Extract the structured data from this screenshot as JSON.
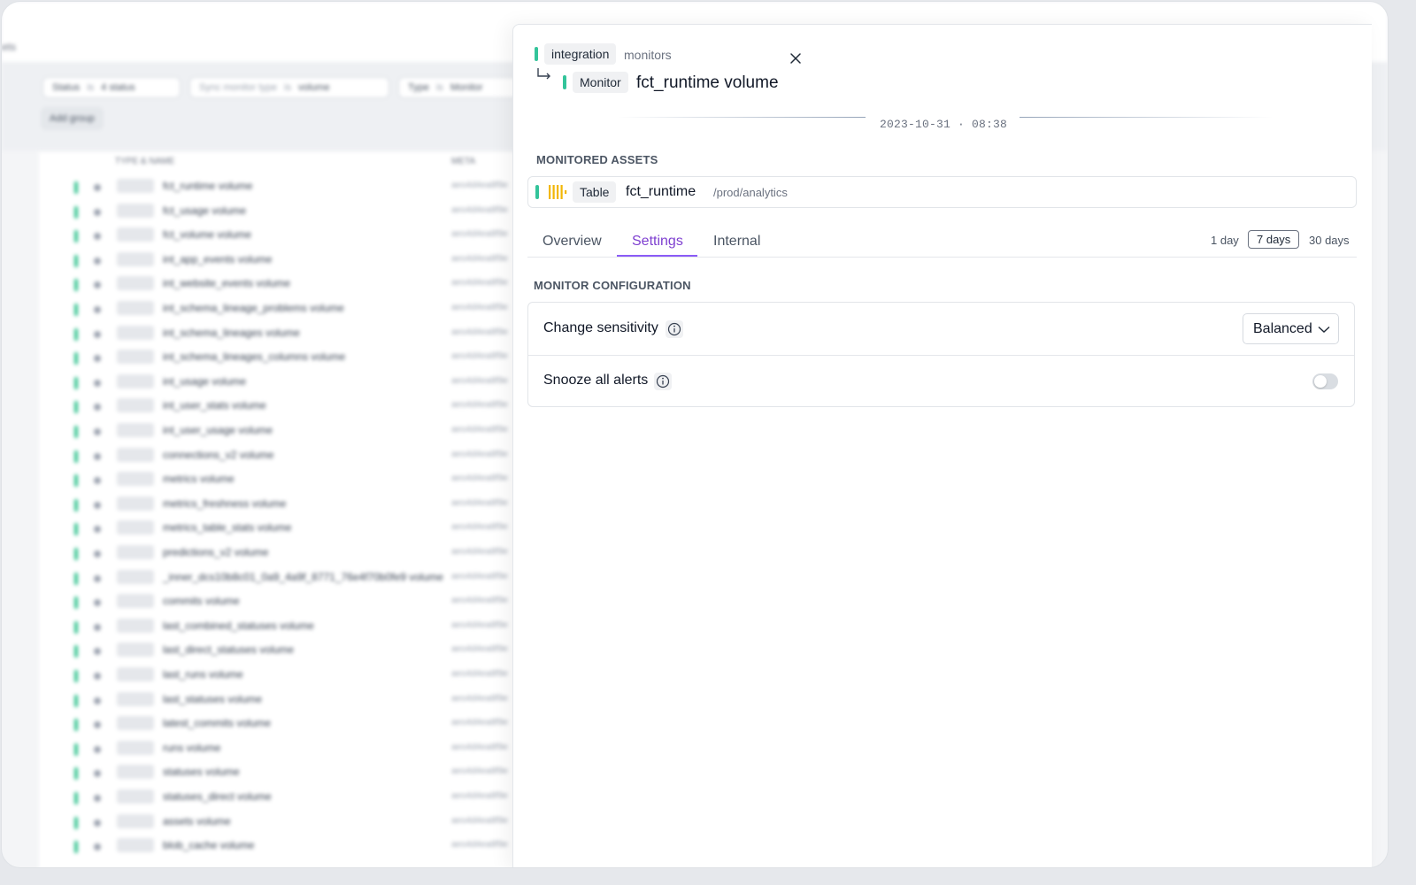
{
  "background": {
    "breadcrumb": "ets",
    "filters": [
      {
        "key": "Status",
        "op": "is",
        "value": "4 status"
      },
      {
        "key": "Sync monitor type",
        "op": "is",
        "value": "volume"
      },
      {
        "key": "Type",
        "op": "is",
        "value": "Monitor"
      }
    ],
    "add_group_label": "Add group",
    "columns": {
      "name": "TYPE & NAME",
      "meta": "META"
    },
    "rows": [
      {
        "name": "fct_runtime volume",
        "hash": "aeo4d4ea8f9e"
      },
      {
        "name": "fct_usage volume",
        "hash": "aeo4d4ea8f9e"
      },
      {
        "name": "fct_volume volume",
        "hash": "aeo4d4ea8f9e"
      },
      {
        "name": "int_app_events volume",
        "hash": "aeo4d4ea8f9e"
      },
      {
        "name": "int_website_events volume",
        "hash": "aeo4d4ea8f9e"
      },
      {
        "name": "int_schema_lineage_problems volume",
        "hash": "aeo4d4ea8f9e"
      },
      {
        "name": "int_schema_lineages volume",
        "hash": "aeo4d4ea8f9e"
      },
      {
        "name": "int_schema_lineages_columns volume",
        "hash": "aeo4d4ea8f9e"
      },
      {
        "name": "int_usage volume",
        "hash": "aeo4d4ea8f9e"
      },
      {
        "name": "int_user_stats volume",
        "hash": "aeo4d4ea8f9e"
      },
      {
        "name": "int_user_usage volume",
        "hash": "aeo4d4ea8f9e"
      },
      {
        "name": "connections_v2 volume",
        "hash": "aeo4d4ea8f9e"
      },
      {
        "name": "metrics volume",
        "hash": "aeo4d4ea8f9e"
      },
      {
        "name": "metrics_freshness volume",
        "hash": "aeo4d4ea8f9e"
      },
      {
        "name": "metrics_table_stats volume",
        "hash": "aeo4d4ea8f9e"
      },
      {
        "name": "predictions_v2 volume",
        "hash": "aeo4d4ea8f9e"
      },
      {
        "name": "_inner_dcs10b8c01_0a9_4a9f_8771_76e4f70b0fe9 volume",
        "hash": "aeo4d4ea8f9e"
      },
      {
        "name": "commits volume",
        "hash": "aeo4d4ea8f9e"
      },
      {
        "name": "last_combined_statuses volume",
        "hash": "aeo4d4ea8f9e"
      },
      {
        "name": "last_direct_statuses volume",
        "hash": "aeo4d4ea8f9e"
      },
      {
        "name": "last_runs volume",
        "hash": "aeo4d4ea8f9e"
      },
      {
        "name": "last_statuses volume",
        "hash": "aeo4d4ea8f9e"
      },
      {
        "name": "latest_commits volume",
        "hash": "aeo4d4ea8f9e"
      },
      {
        "name": "runs volume",
        "hash": "aeo4d4ea8f9e"
      },
      {
        "name": "statuses volume",
        "hash": "aeo4d4ea8f9e"
      },
      {
        "name": "statuses_direct volume",
        "hash": "aeo4d4ea8f9e"
      },
      {
        "name": "assets volume",
        "hash": "aeo4d4ea8f9e"
      },
      {
        "name": "blob_cache volume",
        "hash": "aeo4d4ea8f9e"
      }
    ]
  },
  "panel": {
    "breadcrumb": {
      "tag": "integration",
      "label": "monitors"
    },
    "monitor": {
      "tag": "Monitor",
      "title": "fct_runtime volume"
    },
    "timestamp": "2023-10-31 · 08:38",
    "monitored_assets": {
      "heading": "MONITORED ASSETS",
      "asset": {
        "tag": "Table",
        "name": "fct_runtime",
        "path": "/prod/analytics"
      }
    },
    "tabs": [
      {
        "label": "Overview",
        "active": false
      },
      {
        "label": "Settings",
        "active": true
      },
      {
        "label": "Internal",
        "active": false
      }
    ],
    "ranges": [
      {
        "label": "1 day",
        "selected": false
      },
      {
        "label": "7 days",
        "selected": true
      },
      {
        "label": "30 days",
        "selected": false
      }
    ],
    "config": {
      "heading": "MONITOR CONFIGURATION",
      "sensitivity": {
        "label": "Change sensitivity",
        "value": "Balanced"
      },
      "snooze": {
        "label": "Snooze all alerts",
        "enabled": false
      }
    }
  },
  "colors": {
    "accent_green": "#33c49a",
    "tab_active": "#7e3fd0",
    "table_icon": "#f2b705"
  },
  "icons": [
    "close-icon",
    "return-arrow-icon",
    "table-icon",
    "info-icon",
    "chevron-down-icon"
  ]
}
